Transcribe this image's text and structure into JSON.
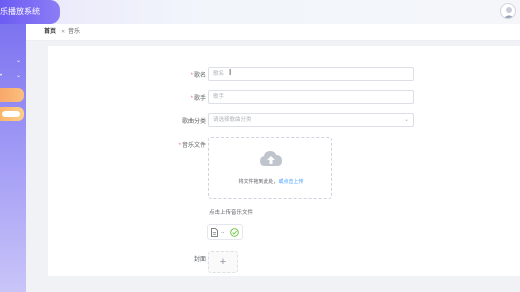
{
  "app": {
    "title": "乐播放系统"
  },
  "breadcrumb": {
    "home": "首页",
    "close": "✕",
    "current": "音乐"
  },
  "form": {
    "name": {
      "label": "歌名",
      "placeholder": "歌名"
    },
    "singer": {
      "label": "歌手",
      "placeholder": "歌手"
    },
    "category": {
      "label": "歌曲分类",
      "placeholder": "请选择歌曲分类"
    },
    "file": {
      "label": "音乐文件",
      "drag_text": "将文件拖到此处，",
      "click_text": "或点击上传",
      "hint": "点击上传音乐文件",
      "uploaded_name": ".."
    },
    "cover": {
      "label": "封面",
      "plus": "+"
    }
  },
  "colors": {
    "brand": "#6d5cf2",
    "link": "#409eff",
    "required": "#f56c6c",
    "success": "#67c23a"
  }
}
